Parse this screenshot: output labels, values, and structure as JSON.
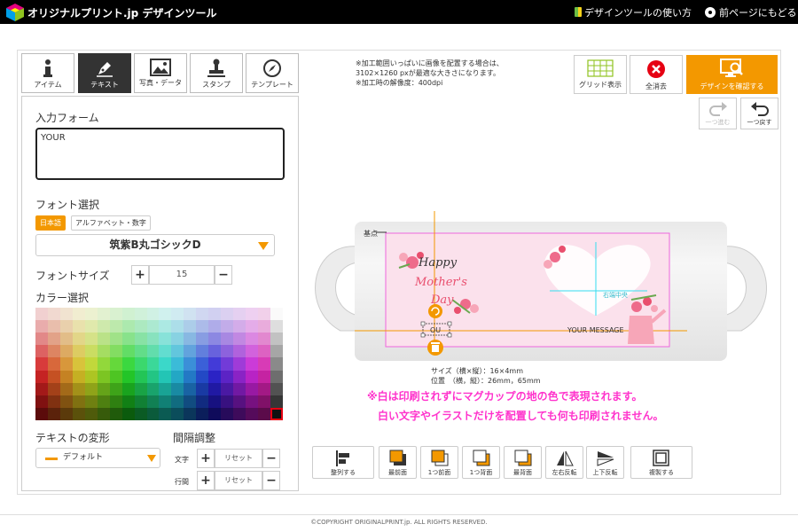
{
  "header": {
    "brand": "オリジナルプリント.jp デザインツール",
    "howto": "デザインツールの使い方",
    "back": "前ページにもどる"
  },
  "tabs": [
    {
      "label": "アイテム",
      "icon": "info-icon"
    },
    {
      "label": "テキスト",
      "icon": "pen-icon",
      "active": true
    },
    {
      "label": "写真・データ",
      "icon": "image-icon"
    },
    {
      "label": "スタンプ",
      "icon": "stamp-icon"
    },
    {
      "label": "テンプレート",
      "icon": "compass-icon"
    }
  ],
  "panel": {
    "input_form_label": "入力フォーム",
    "input_value": "YOUR",
    "font_label": "フォント選択",
    "lang_ja": "日本語",
    "lang_alpha": "アルファベット・数字",
    "font_value": "筑紫B丸ゴシックD",
    "font_size_label": "フォントサイズ",
    "font_size_value": "15",
    "color_label": "カラー選択",
    "transform_label": "テキストの変形",
    "transform_value": "デフォルト",
    "spacing_label": "間隔調整",
    "char_label": "文字",
    "line_label": "行間",
    "reset": "リセット",
    "plus": "+",
    "minus": "−"
  },
  "notes": "※加工範囲いっぱいに画像を配置する場合は、\n3102×1260 pxが最適な大きさになります。\n※加工時の解像度：400dpi",
  "top_buttons": {
    "grid": "グリッド表示",
    "clear": "全消去",
    "confirm": "デザインを確認する",
    "redo": "一つ進む",
    "undo": "一つ戻す"
  },
  "canvas": {
    "origin": "基点",
    "happy": "Happy",
    "mothers": "Mother's",
    "day": "Day",
    "selected_text": "OU",
    "message": "YOUR MESSAGE",
    "center_label": "右端中央"
  },
  "size_info": "サイズ（横×縦）：16×4mm\n位置　（横，縦）：26mm，65mm",
  "white_note": "※白は印刷されずにマグカップの地の色で表現されます。\n　白い文字やイラストだけを配置しても何も印刷されません。",
  "tools": [
    {
      "label": "整列する",
      "icon": "align-icon"
    },
    {
      "label": "最前面",
      "icon": "bring-front-icon"
    },
    {
      "label": "1つ前面",
      "icon": "bring-forward-icon"
    },
    {
      "label": "1つ背面",
      "icon": "send-backward-icon"
    },
    {
      "label": "最背面",
      "icon": "send-back-icon"
    },
    {
      "label": "左右反転",
      "icon": "flip-horizontal-icon"
    },
    {
      "label": "上下反転",
      "icon": "flip-vertical-icon"
    },
    {
      "label": "複製する",
      "icon": "duplicate-icon"
    }
  ],
  "footer": "©COPYRIGHT ORIGINALPRINT.jp. ALL RIGHTS RESERVED.",
  "colors": {
    "accent": "#f39800",
    "header": "#000000",
    "print_area": "#ee66dd",
    "guide": "#f39800",
    "note": "#ff33cc"
  }
}
